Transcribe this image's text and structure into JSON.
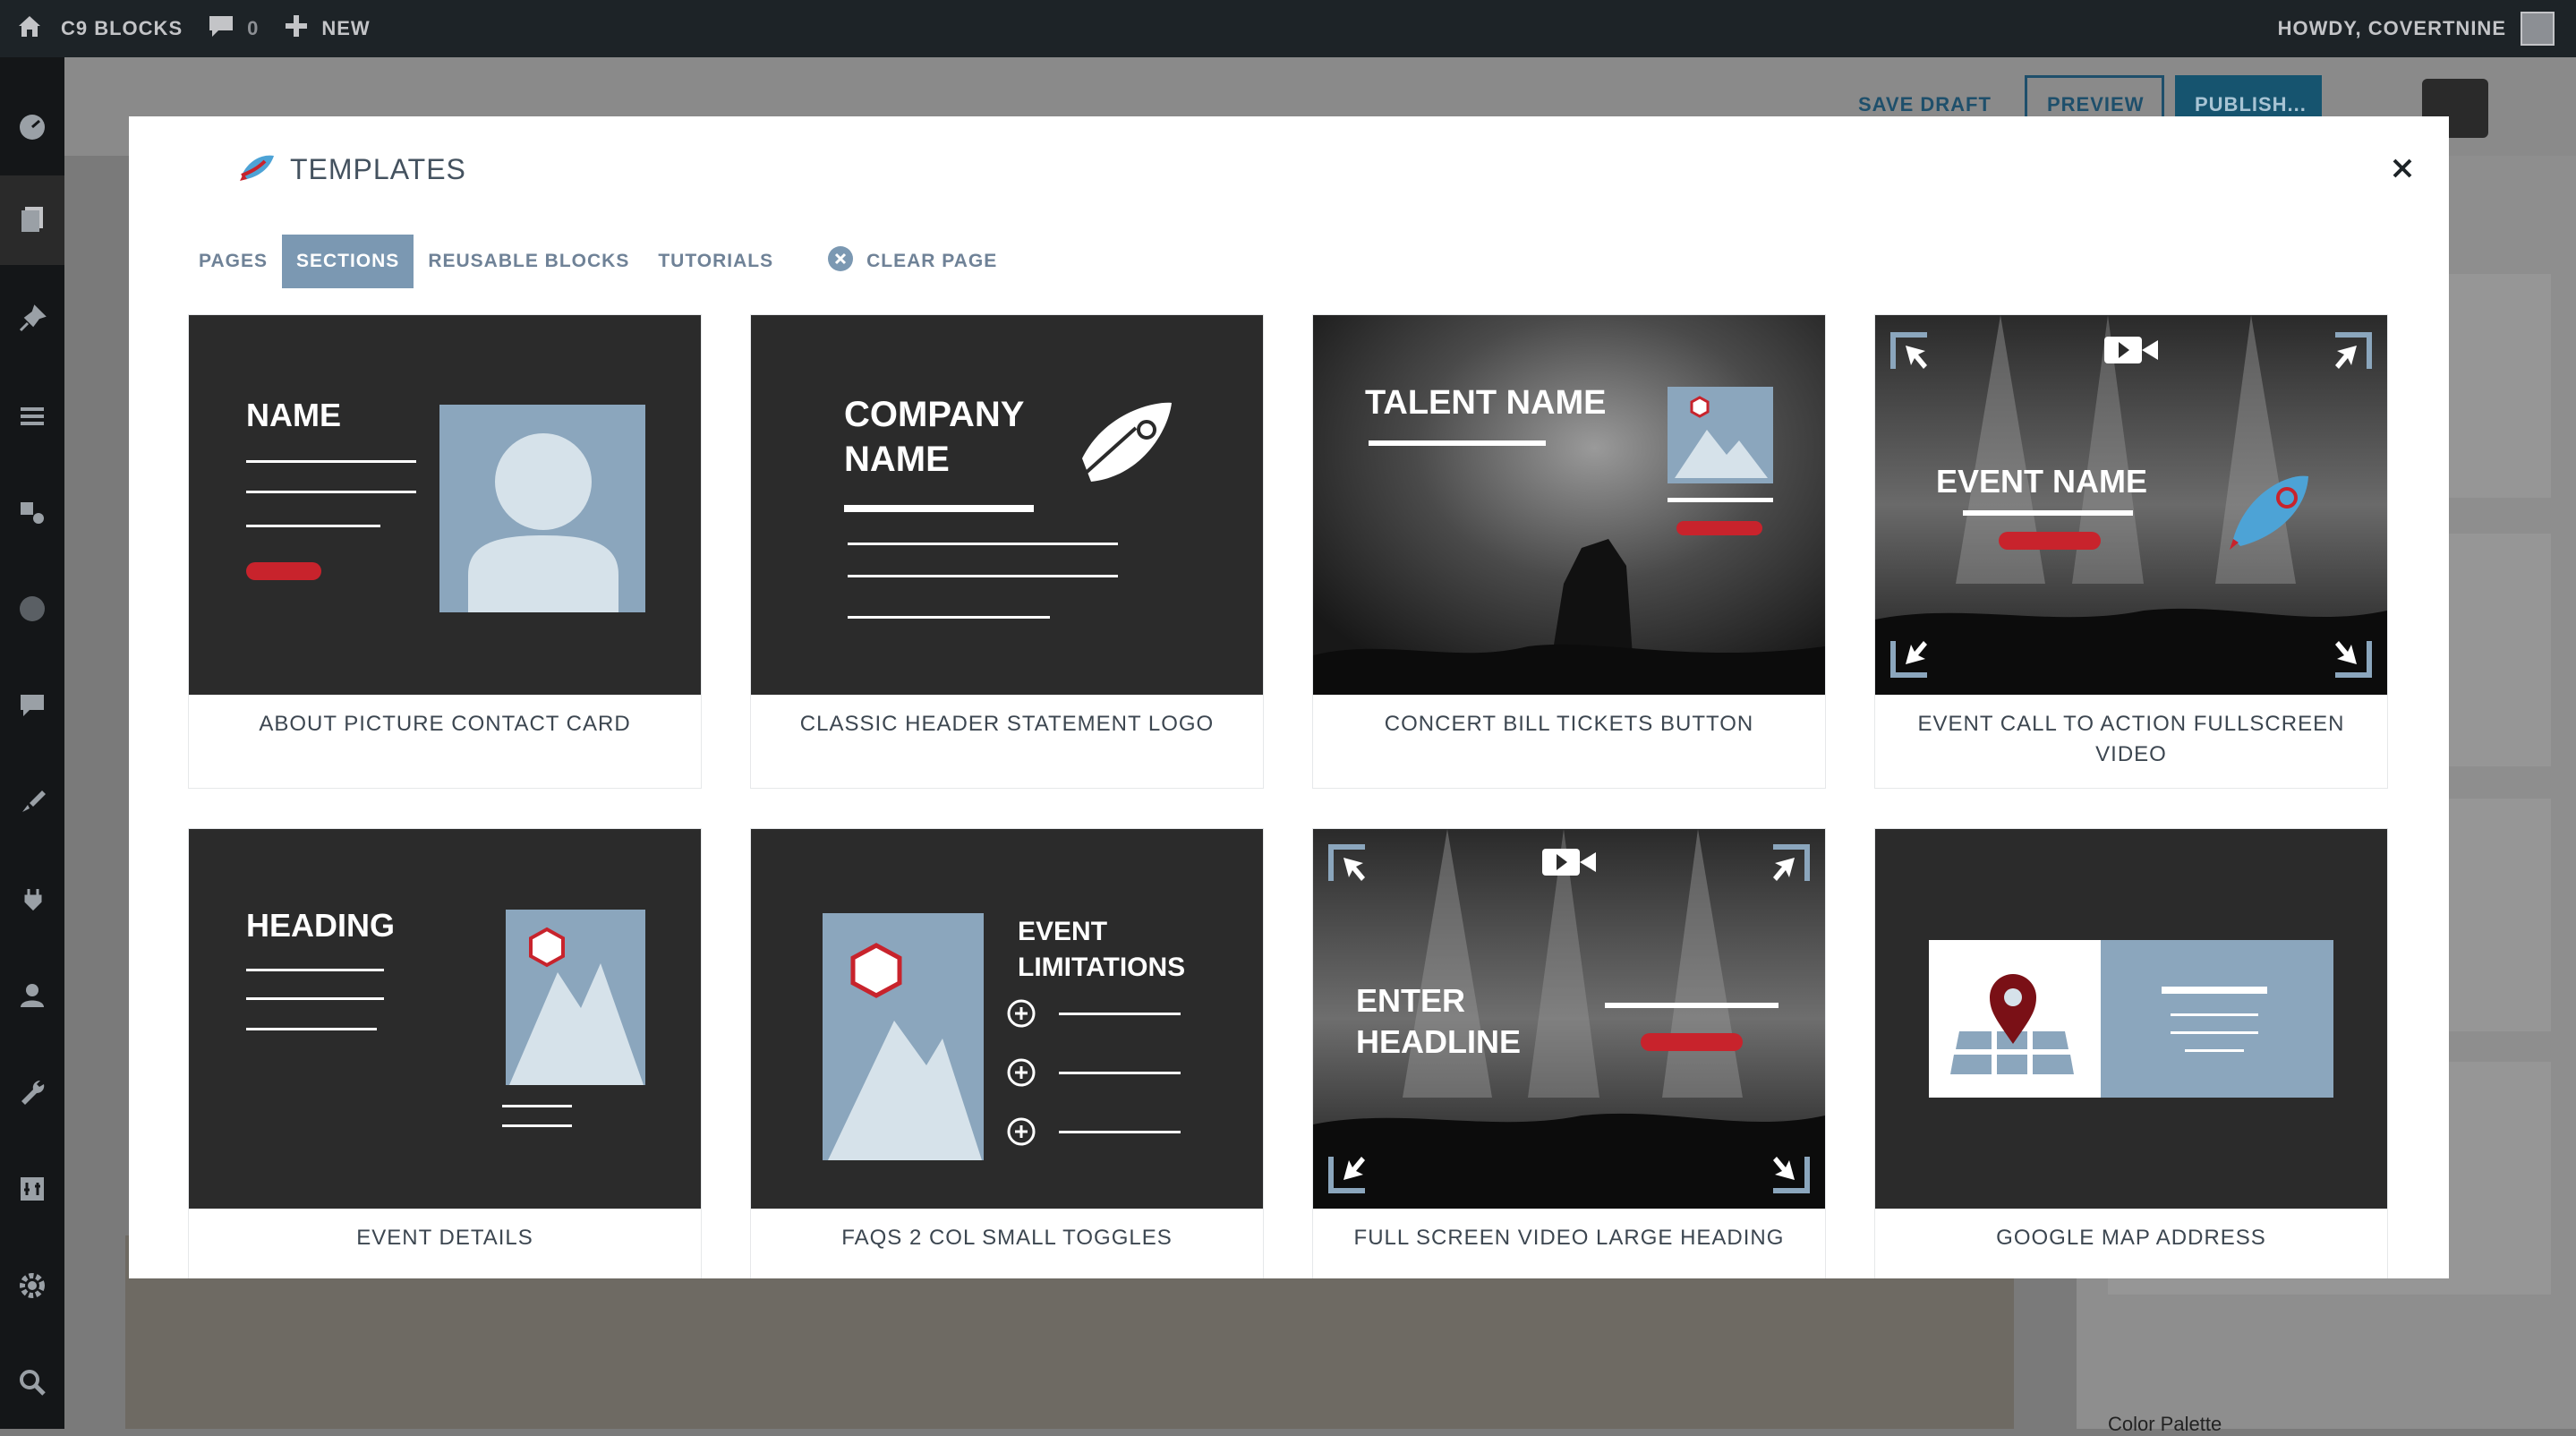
{
  "adminbar": {
    "site_name": "C9 BLOCKS",
    "comments_count": "0",
    "new_label": "NEW",
    "greeting": "HOWDY, COVERTNINE"
  },
  "editor": {
    "save_draft": "SAVE DRAFT",
    "preview": "PREVIEW",
    "publish": "PUBLISH...",
    "sidebar_section": "Color Palette"
  },
  "modal": {
    "title": "TEMPLATES",
    "tabs": [
      {
        "label": "PAGES"
      },
      {
        "label": "SECTIONS"
      },
      {
        "label": "REUSABLE BLOCKS"
      },
      {
        "label": "TUTORIALS"
      }
    ],
    "active_tab": "SECTIONS",
    "clear_label": "CLEAR PAGE",
    "templates": [
      {
        "name": "ABOUT PICTURE CONTACT CARD",
        "thumb_text": [
          "NAME"
        ]
      },
      {
        "name": "CLASSIC HEADER STATEMENT LOGO",
        "thumb_text": [
          "COMPANY",
          "NAME"
        ]
      },
      {
        "name": "CONCERT BILL TICKETS BUTTON",
        "thumb_text": [
          "TALENT NAME"
        ]
      },
      {
        "name": "EVENT CALL TO ACTION FULLSCREEN VIDEO",
        "thumb_text": [
          "EVENT NAME"
        ]
      },
      {
        "name": "EVENT DETAILS",
        "thumb_text": [
          "HEADING"
        ]
      },
      {
        "name": "FAQS 2 COL SMALL TOGGLES",
        "thumb_text": [
          "EVENT",
          "LIMITATIONS"
        ]
      },
      {
        "name": "FULL SCREEN VIDEO LARGE HEADING",
        "thumb_text": [
          "ENTER",
          "HEADLINE"
        ]
      },
      {
        "name": "GOOGLE MAP ADDRESS",
        "thumb_text": []
      }
    ]
  },
  "colors": {
    "thumb_bg": "#2b2b2b",
    "thumb_blue": "#8ba6bd",
    "thumb_light": "#d6e2ea",
    "accent_red": "#c8232c",
    "tab_active": "#7b98b2"
  }
}
